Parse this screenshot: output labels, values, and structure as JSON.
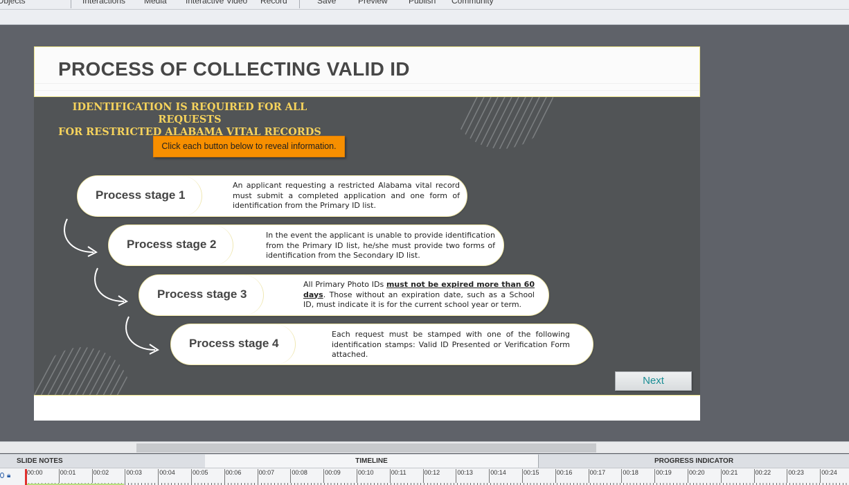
{
  "menu": {
    "items": [
      "Objects",
      "Interactions",
      "Media",
      "Interactive Video",
      "Record",
      "Save",
      "Preview",
      "Publish",
      "Community"
    ]
  },
  "slide": {
    "title": "PROCESS OF COLLECTING VALID ID",
    "requirement_line1": "IDENTIFICATION IS REQUIRED FOR ALL REQUESTS",
    "requirement_line2": "FOR RESTRICTED ALABAMA VITAL RECORDS",
    "instruction_button": "Click each button below to reveal information.",
    "stages": [
      {
        "label": "Process stage 1",
        "text": "An applicant requesting a restricted Alabama vital record must submit a completed application and one form of identification from the Primary ID list."
      },
      {
        "label": "Process stage 2",
        "text": "In the event the applicant is unable to provide identification from the Primary ID list, he/she must provide two forms of identification from the Secondary ID list."
      },
      {
        "label": "Process stage 3",
        "text_before": "All Primary Photo IDs ",
        "text_emphasis": "must not be expired more than 60 days",
        "text_after": ". Those without an expiration date, such as a School ID, must indicate it is for the current school year or term."
      },
      {
        "label": "Process stage 4",
        "text": "Each request must be stamped with one of the following identification stamps: Valid ID Presented or Verification Form attached."
      }
    ],
    "next_button": "Next"
  },
  "panels": {
    "slide_notes": "SLIDE NOTES",
    "timeline": "TIMELINE",
    "progress_indicator": "PROGRESS INDICATOR"
  },
  "timeline": {
    "labels": [
      "00:00",
      "00:01",
      "00:02",
      "00:03",
      "00:04",
      "00:05",
      "00:06",
      "00:07",
      "00:08",
      "00:09",
      "00:10",
      "00:11",
      "00:12",
      "00:13",
      "00:14",
      "00:15",
      "00:16",
      "00:17",
      "00:18",
      "00:19",
      "00:20",
      "00:21",
      "00:22",
      "00:23",
      "00:24"
    ]
  },
  "colors": {
    "accent_yellow": "#f6d35c",
    "orange_button": "#f78f00",
    "slide_bg": "#515456",
    "next_text": "#1b8e95"
  }
}
